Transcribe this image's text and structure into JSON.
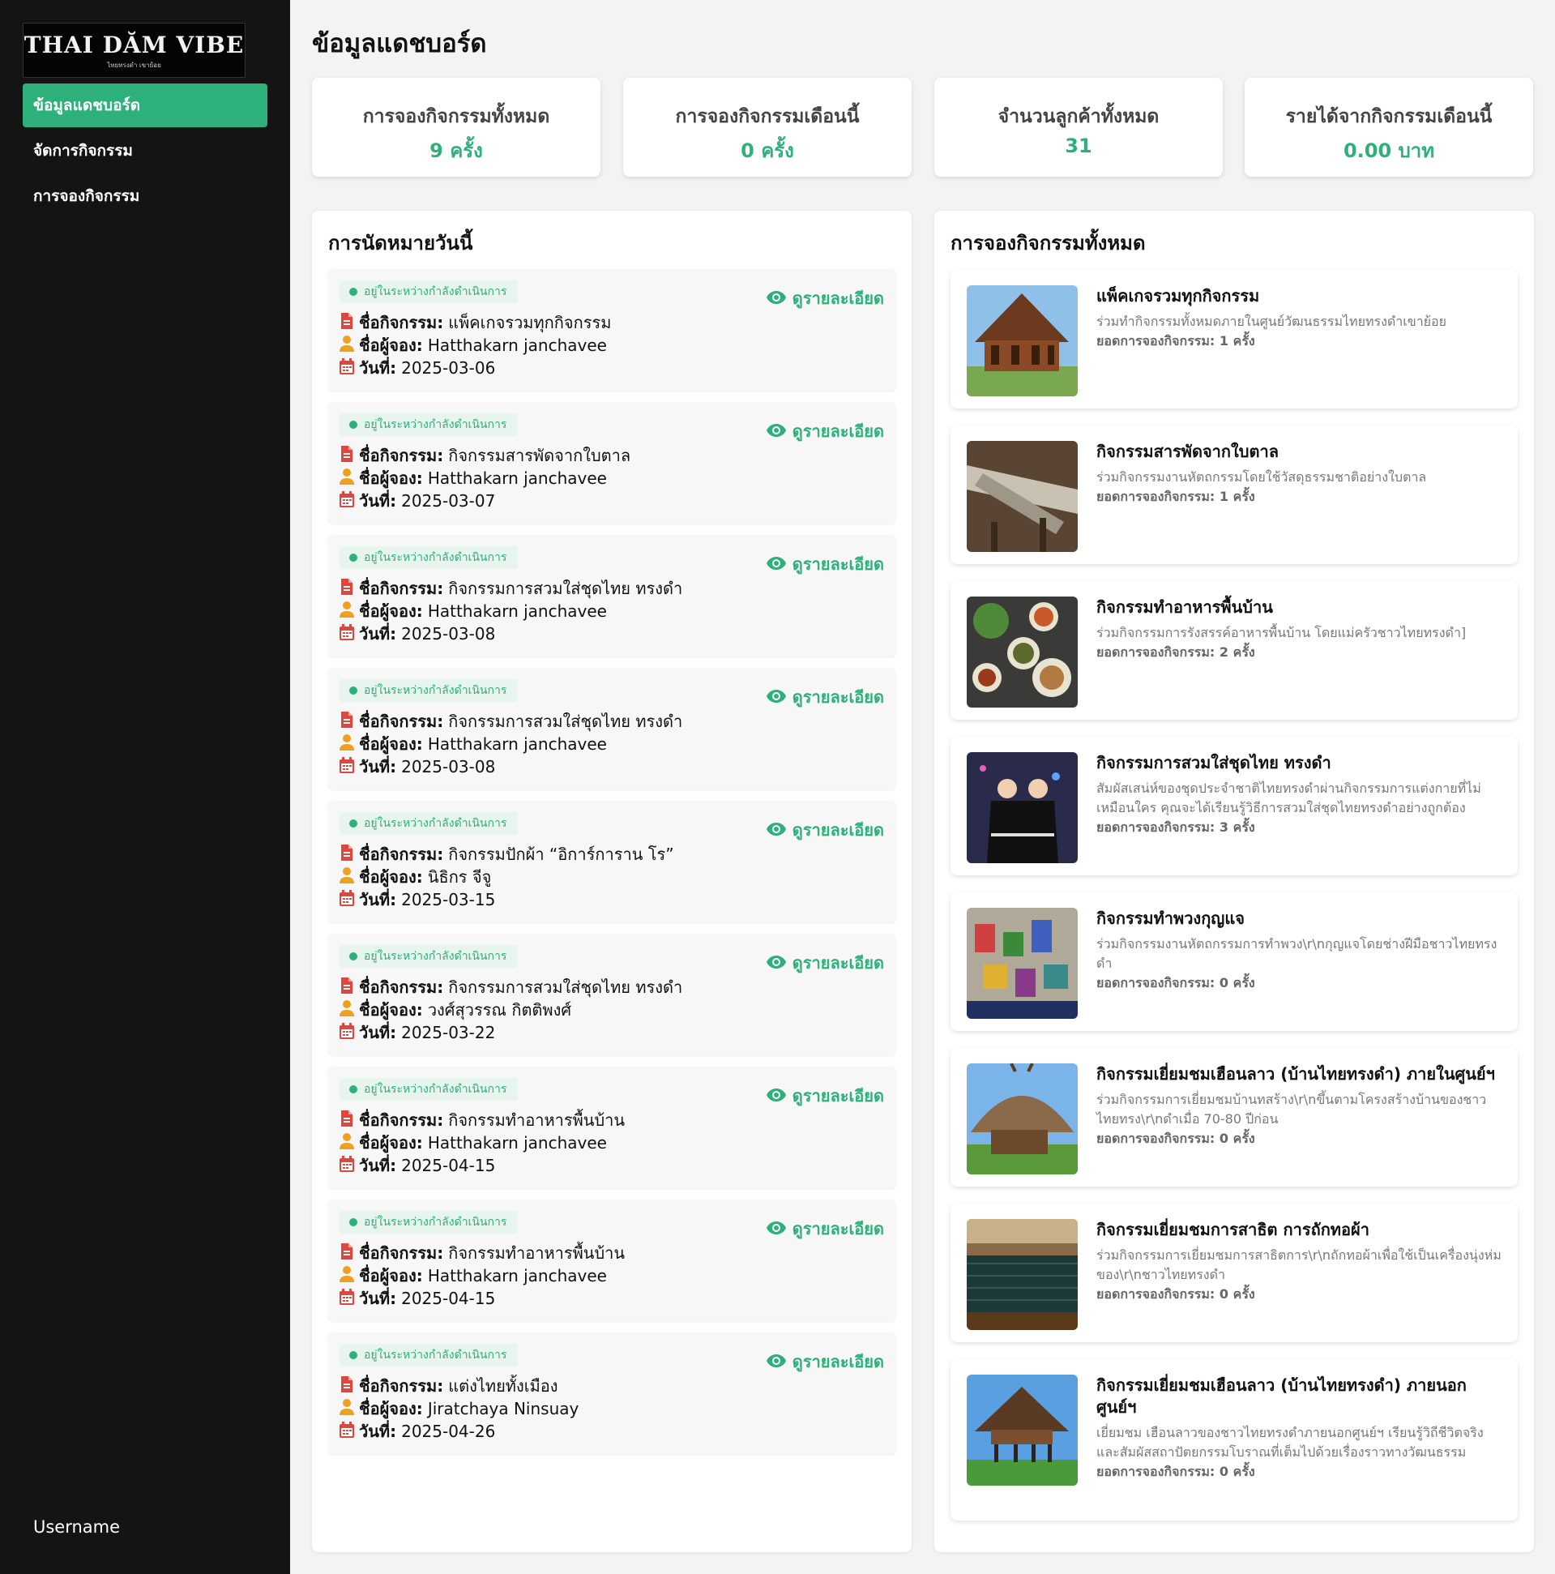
{
  "sidebar": {
    "logo_text": "THAI DĂM VIBE",
    "logo_subtext": "ไทยทรงดำ เขาย้อย",
    "items": [
      {
        "label": "ข้อมูลแดชบอร์ด",
        "active": true
      },
      {
        "label": "จัดการกิจกรรม",
        "active": false
      },
      {
        "label": "การจองกิจกรรม",
        "active": false
      }
    ],
    "username": "Username"
  },
  "page_title": "ข้อมูลแดชบอร์ด",
  "stats": [
    {
      "label": "การจองกิจกรรมทั้งหมด",
      "value": "9 ครั้ง"
    },
    {
      "label": "การจองกิจกรรมเดือนนี้",
      "value": "0 ครั้ง"
    },
    {
      "label": "จำนวนลูกค้าทั้งหมด",
      "value": "31"
    },
    {
      "label": "รายได้จากกิจกรรมเดือนนี้",
      "value": "0.00 บาท"
    }
  ],
  "appointments": {
    "title": "การนัดหมายวันนี้",
    "status_label": "อยู่ในระหว่างกำลังดำเนินการ",
    "view_label": "ดูรายละเอียด",
    "activity_label": "ชื่อกิจกรรม:",
    "booker_label": "ชื่อผู้จอง:",
    "date_label": "วันที่:",
    "items": [
      {
        "activity": "แพ็คเกจรวมทุกกิจกรรม",
        "booker": "Hatthakarn janchavee",
        "date": "2025-03-06"
      },
      {
        "activity": "กิจกรรมสารพัดจากใบตาล",
        "booker": "Hatthakarn janchavee",
        "date": "2025-03-07"
      },
      {
        "activity": "กิจกรรมการสวมใส่ชุดไทย ทรงดำ",
        "booker": "Hatthakarn janchavee",
        "date": "2025-03-08"
      },
      {
        "activity": "กิจกรรมการสวมใส่ชุดไทย ทรงดำ",
        "booker": "Hatthakarn janchavee",
        "date": "2025-03-08"
      },
      {
        "activity": "กิจกรรมปักผ้า “อิการ์การาน โร”",
        "booker": "นิธิกร จีจู",
        "date": "2025-03-15"
      },
      {
        "activity": "กิจกรรมการสวมใส่ชุดไทย ทรงดำ",
        "booker": "วงศ์สุวรรณ กิตติพงศ์",
        "date": "2025-03-22"
      },
      {
        "activity": "กิจกรรมทำอาหารพื้นบ้าน",
        "booker": "Hatthakarn janchavee",
        "date": "2025-04-15"
      },
      {
        "activity": "กิจกรรมทำอาหารพื้นบ้าน",
        "booker": "Hatthakarn janchavee",
        "date": "2025-04-15"
      },
      {
        "activity": "แต่งไทยทั้งเมือง",
        "booker": "Jiratchaya Ninsuay",
        "date": "2025-04-26"
      }
    ]
  },
  "activities": {
    "title": "การจองกิจกรรมทั้งหมด",
    "count_label": "ยอดการจองกิจกรรม:",
    "items": [
      {
        "title": "แพ็คเกจรวมทุกกิจกรรม",
        "desc": "ร่วมทำกิจกรรมทั้งหมดภายในศูนย์วัฒนธรรมไทยทรงดำเขาย้อย",
        "count": "1 ครั้ง",
        "thumb": "house"
      },
      {
        "title": "กิจกรรมสารพัดจากใบตาล",
        "desc": "ร่วมกิจกรรมงานหัตถกรรมโดยใช้วัสดุธรรมชาติอย่างใบตาล",
        "count": "1 ครั้ง",
        "thumb": "palm"
      },
      {
        "title": "กิจกรรมทำอาหารพื้นบ้าน",
        "desc": "ร่วมกิจกรรมการรังสรรค์อาหารพื้นบ้าน โดยแม่ครัวชาวไทยทรงดำ]",
        "count": "2 ครั้ง",
        "thumb": "food"
      },
      {
        "title": "กิจกรรมการสวมใส่ชุดไทย ทรงดำ",
        "desc": "สัมผัสเสน่ห์ของชุดประจำชาติไทยทรงดำผ่านกิจกรรมการแต่งกายที่ไม่เหมือนใคร คุณจะได้เรียนรู้วิธีการสวมใส่ชุดไทยทรงดำอย่างถูกต้อง",
        "count": "3 ครั้ง",
        "thumb": "costume"
      },
      {
        "title": "กิจกรรมทำพวงกุญแจ",
        "desc": "ร่วมกิจกรรมงานหัตถกรรมการทำพวง\\r\\nกุญแจโดยช่างฝีมือชาวไทยทรงดำ",
        "count": "0 ครั้ง",
        "thumb": "keychain"
      },
      {
        "title": "กิจกรรมเยี่ยมชมเฮือนลาว (บ้านไทยทรงดำ) ภายในศูนย์ฯ",
        "desc": "ร่วมกิจกรรมการเยี่ยมชมบ้านทสร้าง\\r\\nขึ้นตามโครงสร้างบ้านของชาวไทยทรง\\r\\nดำเมื่อ 70-80 ปีก่อน",
        "count": "0 ครั้ง",
        "thumb": "hut"
      },
      {
        "title": "กิจกรรมเยี่ยมชมการสาธิต การถักทอผ้า",
        "desc": "ร่วมกิจกรรมการเยี่ยมชมการสาธิตการ\\r\\nถักทอผ้าเพื่อใช้เป็นเครื่องนุ่งห่มของ\\r\\nชาวไทยทรงดำ",
        "count": "0 ครั้ง",
        "thumb": "loom"
      },
      {
        "title": "กิจกรรมเยี่ยมชมเฮือนลาว (บ้านไทยทรงดำ) ภายนอกศูนย์ฯ",
        "desc": "เยี่ยมชม เฮือนลาวของชาวไทยทรงดำภายนอกศูนย์ฯ เรียนรู้วิถีชีวิตจริงและสัมผัสสถาปัตยกรรมโบราณที่เต็มไปด้วยเรื่องราวทางวัฒนธรรม",
        "count": "0 ครั้ง",
        "thumb": "stilt-house"
      }
    ]
  },
  "colors": {
    "accent": "#2db07a",
    "sidebar_bg": "#141414",
    "page_bg": "#f3f3f3"
  },
  "icons": {
    "view": "eye-icon",
    "activity": "document-icon",
    "booker": "user-icon",
    "date": "calendar-icon"
  }
}
